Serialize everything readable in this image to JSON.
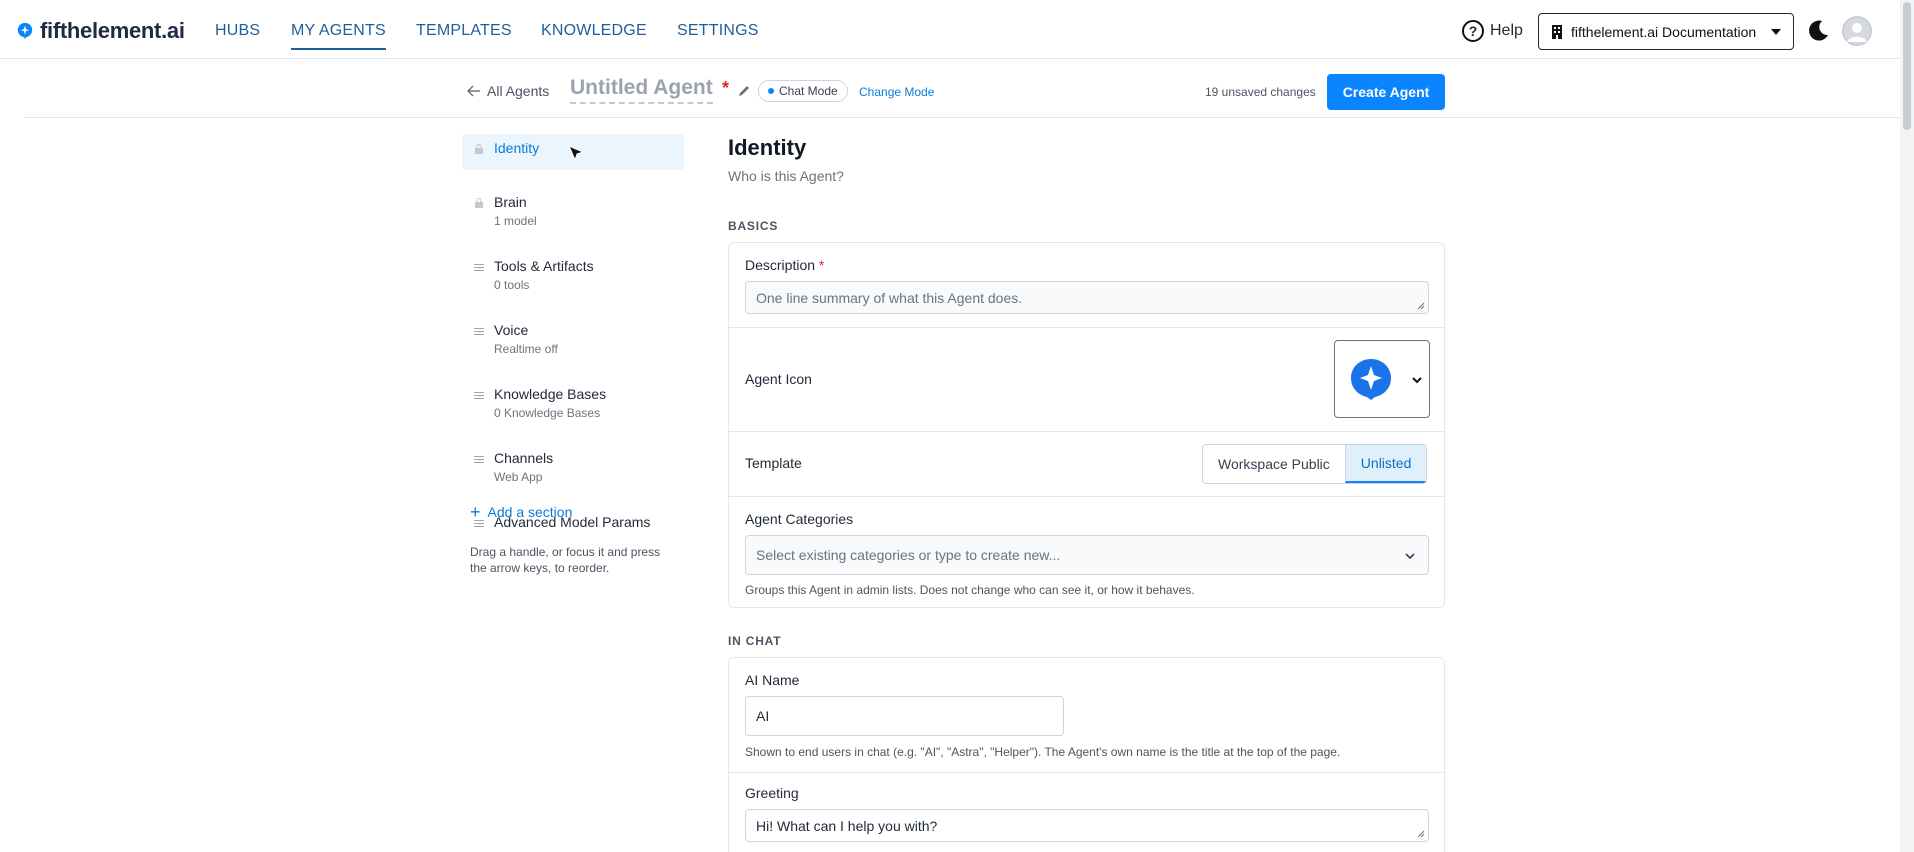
{
  "nav": {
    "brand": "fifthelement.ai",
    "links": [
      "HUBS",
      "MY AGENTS",
      "TEMPLATES",
      "KNOWLEDGE",
      "SETTINGS"
    ],
    "active_index": 1,
    "help_label": "Help",
    "org_select": "fifthelement.ai Documentation"
  },
  "subheader": {
    "back_label": "All Agents",
    "agent_title": "Untitled Agent",
    "required_mark": "*",
    "mode": "Chat Mode",
    "change_mode": "Change Mode",
    "unsaved": "19 unsaved changes",
    "create_button": "Create Agent"
  },
  "sidebar": {
    "items": [
      {
        "label": "Identity",
        "sub": "",
        "active": true,
        "locked": true
      },
      {
        "label": "Brain",
        "sub": "1 model",
        "locked": true
      },
      {
        "label": "Tools & Artifacts",
        "sub": "0 tools"
      },
      {
        "label": "Voice",
        "sub": "Realtime off"
      },
      {
        "label": "Knowledge Bases",
        "sub": "0 Knowledge Bases"
      },
      {
        "label": "Channels",
        "sub": "Web App"
      },
      {
        "label": "Advanced Model Params",
        "sub": ""
      }
    ],
    "add_section": "Add a section",
    "drag_hint": "Drag a handle, or focus it and press the arrow keys, to reorder."
  },
  "main": {
    "title": "Identity",
    "subtitle": "Who is this Agent?",
    "basics_label": "BASICS",
    "description_label": "Description",
    "description_placeholder": "One line summary of what this Agent does.",
    "agent_icon_label": "Agent Icon",
    "template_label": "Template",
    "template_options": [
      "Workspace Public",
      "Unlisted"
    ],
    "template_selected": "Unlisted",
    "categories_label": "Agent Categories",
    "categories_placeholder": "Select existing categories or type to create new...",
    "categories_help": "Groups this Agent in admin lists. Does not change who can see it, or how it behaves.",
    "in_chat_label": "IN CHAT",
    "ai_name_label": "AI Name",
    "ai_name_value": "AI",
    "ai_name_help": "Shown to end users in chat (e.g. \"AI\", \"Astra\", \"Helper\"). The Agent's own name is the title at the top of the page.",
    "greeting_label": "Greeting",
    "greeting_value": "Hi! What can I help you with?"
  },
  "colors": {
    "accent": "#0a84ff",
    "nav_link": "#1f5f99",
    "required": "#dc2626"
  }
}
